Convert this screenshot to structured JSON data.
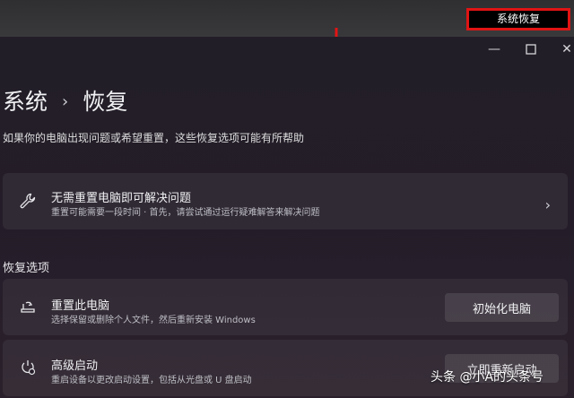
{
  "callout": {
    "label": "系统恢复"
  },
  "breadcrumb": {
    "parent": "系统",
    "current": "恢复"
  },
  "subtitle": "如果你的电脑出现问题或希望重置，这些恢复选项可能有所帮助",
  "troubleshoot_card": {
    "title": "无需重置电脑即可解决问题",
    "description": "重置可能需要一段时间 · 首先，请尝试通过运行疑难解答来解决问题"
  },
  "section": {
    "label": "恢复选项"
  },
  "options": [
    {
      "title": "重置此电脑",
      "description": "选择保留或删除个人文件，然后重新安装 Windows",
      "button": "初始化电脑"
    },
    {
      "title": "高级启动",
      "description": "重启设备以更改启动设置，包括从光盘或 U 盘启动",
      "button": "立即重新启动"
    }
  ],
  "watermark": "头条 @小A的头条号",
  "colors": {
    "callout_border": "#e11414",
    "arrow": "#e11414",
    "card_bg": "rgba(255,255,255,0.06)"
  },
  "icons": [
    "arrow-down-icon",
    "minimize-icon",
    "maximize-icon",
    "close-icon",
    "wrench-icon",
    "reset-pc-icon",
    "advanced-startup-icon",
    "chevron-right-icon"
  ]
}
